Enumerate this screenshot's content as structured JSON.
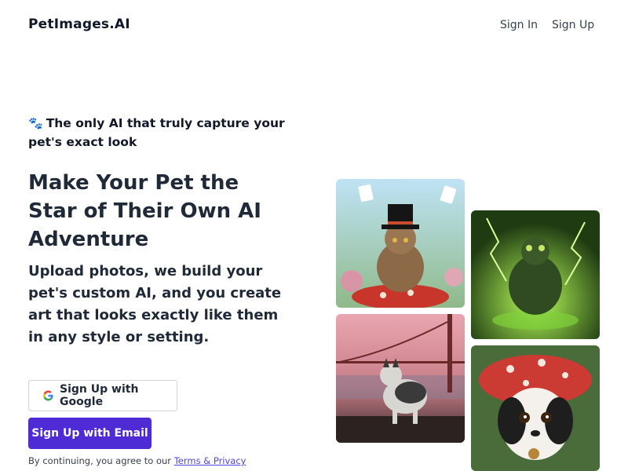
{
  "header": {
    "logo": "PetImages.AI",
    "sign_in": "Sign In",
    "sign_up": "Sign Up"
  },
  "hero": {
    "tagline": "The only AI that truly capture your pet's exact look",
    "headline": "Make Your Pet the Star of Their Own AI Adventure",
    "subtext": "Upload photos, we build your pet's custom AI, and you create art that looks exactly like them in any style or setting."
  },
  "actions": {
    "google_label": "Sign Up with Google",
    "email_label": "Sign Up with Email"
  },
  "legal": {
    "prefix": "By continuing, you agree to our",
    "link": "Terms & Privacy"
  },
  "gallery": [
    {
      "name": "cat-top-hat-image"
    },
    {
      "name": "frog-lightning-image"
    },
    {
      "name": "husky-golden-gate-image"
    },
    {
      "name": "puppy-mushroom-hat-image"
    }
  ],
  "colors": {
    "primary": "#4f2bd6",
    "link": "#4f46e5",
    "text": "#1f2937"
  },
  "icons": {
    "tagline_icon": "paw-prints-icon",
    "google_icon": "google-g-icon"
  }
}
